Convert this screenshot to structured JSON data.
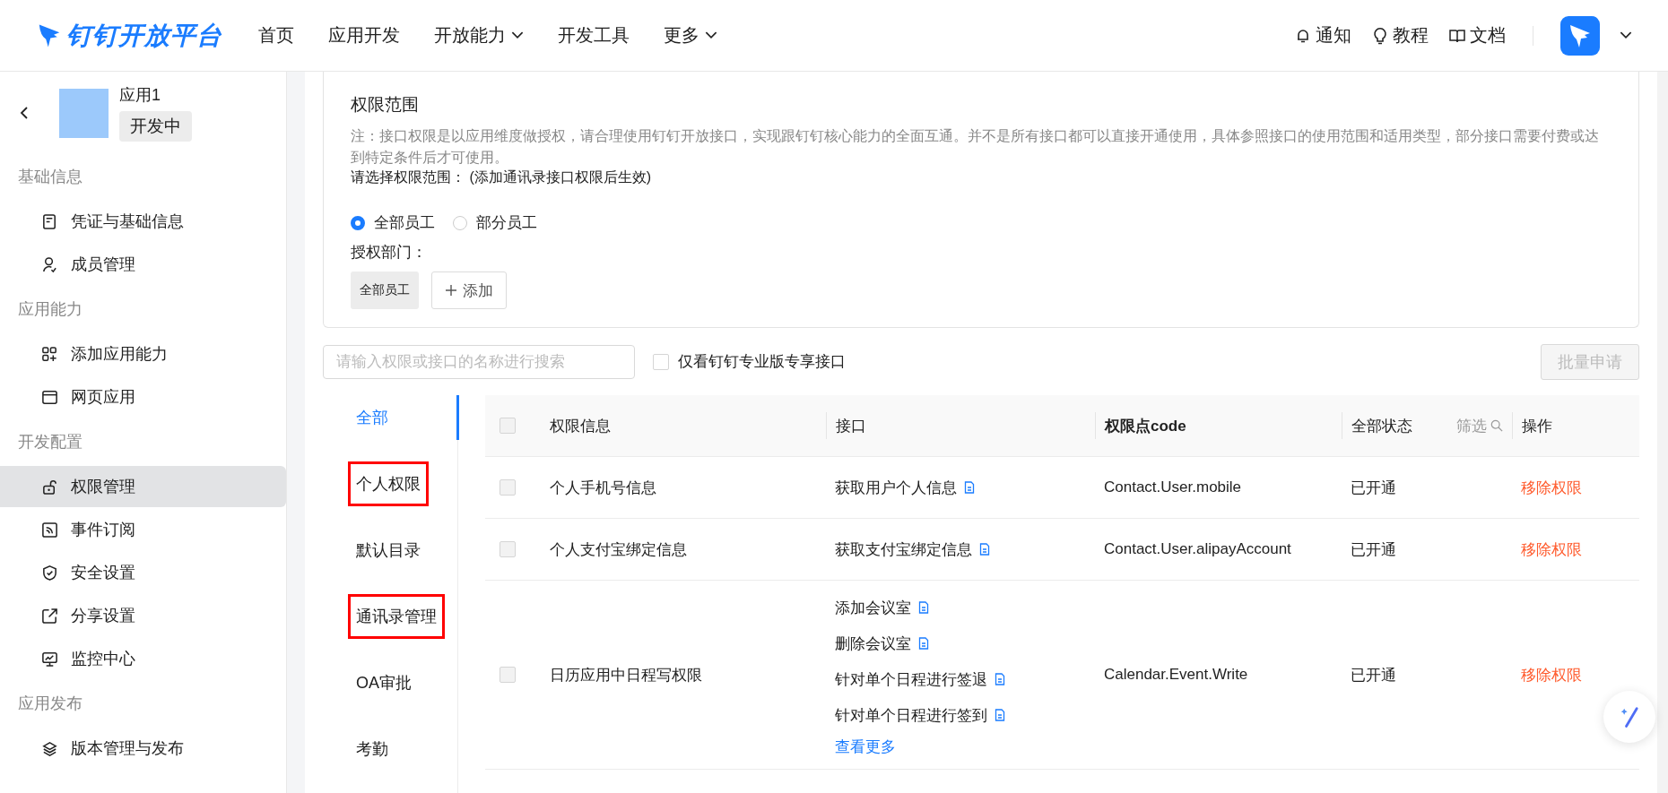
{
  "header": {
    "logo": "钉钉开放平台",
    "nav": [
      {
        "label": "首页",
        "dropdown": false
      },
      {
        "label": "应用开发",
        "dropdown": false
      },
      {
        "label": "开放能力",
        "dropdown": true
      },
      {
        "label": "开发工具",
        "dropdown": false
      },
      {
        "label": "更多",
        "dropdown": true
      }
    ],
    "links": [
      {
        "label": "通知",
        "kind": "bell"
      },
      {
        "label": "教程",
        "kind": "bulb"
      },
      {
        "label": "文档",
        "kind": "book"
      }
    ]
  },
  "sidebar": {
    "app": {
      "name": "应用1",
      "status": "开发中"
    },
    "groups": [
      {
        "title": "基础信息",
        "items": [
          {
            "label": "凭证与基础信息",
            "kind": "card",
            "selected": false
          },
          {
            "label": "成员管理",
            "kind": "user",
            "selected": false
          }
        ]
      },
      {
        "title": "应用能力",
        "items": [
          {
            "label": "添加应用能力",
            "kind": "grid",
            "selected": false
          },
          {
            "label": "网页应用",
            "kind": "browser",
            "selected": false
          }
        ]
      },
      {
        "title": "开发配置",
        "items": [
          {
            "label": "权限管理",
            "kind": "lock",
            "selected": true
          },
          {
            "label": "事件订阅",
            "kind": "rss",
            "selected": false
          },
          {
            "label": "安全设置",
            "kind": "shield",
            "selected": false
          },
          {
            "label": "分享设置",
            "kind": "share",
            "selected": false
          },
          {
            "label": "监控中心",
            "kind": "monitor",
            "selected": false
          }
        ]
      },
      {
        "title": "应用发布",
        "items": [
          {
            "label": "版本管理与发布",
            "kind": "layers",
            "selected": false
          }
        ]
      }
    ]
  },
  "scope": {
    "title": "权限范围",
    "note": "注：接口权限是以应用维度做授权，请合理使用钉钉开放接口，实现跟钉钉核心能力的全面互通。并不是所有接口都可以直接开通使用，具体参照接口的使用范围和适用类型，部分接口需要付费或达到特定条件后才可使用。",
    "prompt": "请选择权限范围： (添加通讯录接口权限后生效)",
    "options": [
      {
        "label": "全部员工",
        "selected": true
      },
      {
        "label": "部分员工",
        "selected": false
      }
    ],
    "dept_label": "授权部门：",
    "dept_tags": [
      "全部员工"
    ],
    "add_button": "添加"
  },
  "toolbar": {
    "search_placeholder": "请输入权限或接口的名称进行搜索",
    "pro_only": {
      "label": "仅看钉钉专业版专享接口",
      "checked": false
    },
    "batch_button": {
      "label": "批量申请",
      "disabled": true
    }
  },
  "categories": [
    {
      "label": "全部",
      "selected": true,
      "highlighted": false
    },
    {
      "label": "个人权限",
      "selected": false,
      "highlighted": true
    },
    {
      "label": "默认目录",
      "selected": false,
      "highlighted": false
    },
    {
      "label": "通讯录管理",
      "selected": false,
      "highlighted": true
    },
    {
      "label": "OA审批",
      "selected": false,
      "highlighted": false
    },
    {
      "label": "考勤",
      "selected": false,
      "highlighted": false
    }
  ],
  "table": {
    "all_checked": false,
    "columns": [
      "权限信息",
      "接口",
      "权限点code",
      "全部状态",
      "操作"
    ],
    "filter": "筛选",
    "rows": [
      {
        "name": "个人手机号信息",
        "checked": false,
        "apis": [
          "获取用户个人信息"
        ],
        "code": "Contact.User.mobile",
        "status": "已开通",
        "action": "移除权限"
      },
      {
        "name": "个人支付宝绑定信息",
        "checked": false,
        "apis": [
          "获取支付宝绑定信息"
        ],
        "code": "Contact.User.alipayAccount",
        "status": "已开通",
        "action": "移除权限"
      },
      {
        "name": "日历应用中日程写权限",
        "checked": false,
        "apis": [
          "添加会议室",
          "删除会议室",
          "针对单个日程进行签退",
          "针对单个日程进行签到"
        ],
        "more": "查看更多",
        "code": "Calendar.Event.Write",
        "status": "已开通",
        "action": "移除权限"
      }
    ]
  }
}
